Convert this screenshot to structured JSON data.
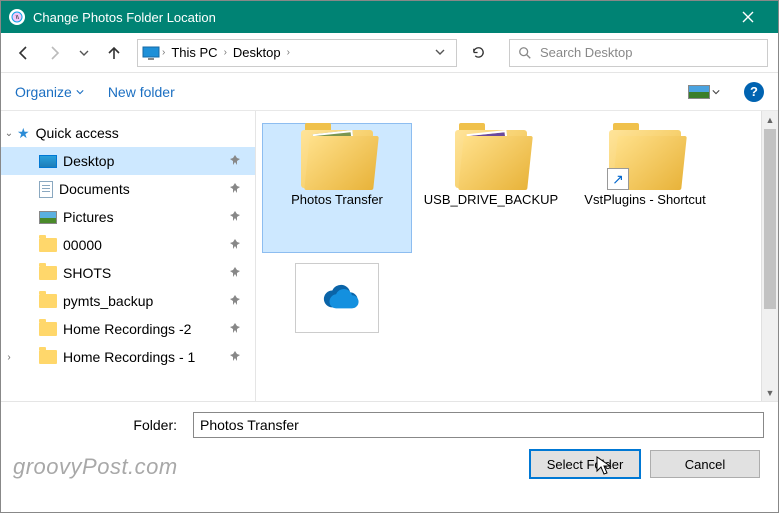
{
  "titlebar": {
    "title": "Change Photos Folder Location"
  },
  "breadcrumbs": {
    "root": "This PC",
    "folder": "Desktop"
  },
  "search": {
    "placeholder": "Search Desktop"
  },
  "toolbar": {
    "organize": "Organize",
    "newfolder": "New folder",
    "help": "?"
  },
  "sidebar": {
    "quick_access": "Quick access",
    "items": [
      {
        "label": "Desktop",
        "icon": "monitor",
        "selected": true,
        "pinned": true
      },
      {
        "label": "Documents",
        "icon": "doc",
        "pinned": true
      },
      {
        "label": "Pictures",
        "icon": "pic",
        "pinned": true
      },
      {
        "label": "00000",
        "icon": "folder",
        "pinned": true
      },
      {
        "label": "SHOTS",
        "icon": "folder",
        "pinned": true
      },
      {
        "label": "pymts_backup",
        "icon": "folder",
        "pinned": true
      },
      {
        "label": "Home Recordings -2",
        "icon": "folder",
        "pinned": true
      },
      {
        "label": "Home Recordings - 1",
        "icon": "folder",
        "pinned": true
      }
    ]
  },
  "content": {
    "items": [
      {
        "label": "Photos Transfer",
        "selected": true,
        "preview": "green"
      },
      {
        "label": "USB_DRIVE_BACKUP",
        "preview": "purple"
      },
      {
        "label": "VstPlugins - Shortcut",
        "shortcut": true
      }
    ]
  },
  "footer": {
    "folder_label": "Folder:",
    "folder_value": "Photos Transfer",
    "select_btn": "Select Folder",
    "cancel_btn": "Cancel"
  },
  "watermark": "groovyPost.com"
}
